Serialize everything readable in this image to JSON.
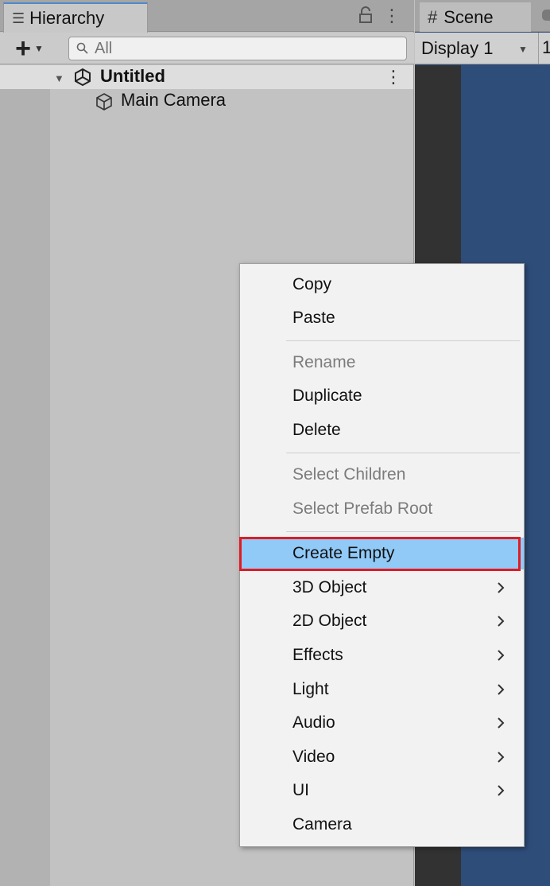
{
  "hierarchy": {
    "tab_label": "Hierarchy",
    "search_placeholder": "All",
    "scene_name": "Untitled",
    "items": [
      {
        "label": "Main Camera"
      }
    ]
  },
  "scene_panel": {
    "tab_label": "Scene",
    "display_select": "Display 1",
    "truncated_text": "1"
  },
  "context_menu": {
    "copy": "Copy",
    "paste": "Paste",
    "rename": "Rename",
    "duplicate": "Duplicate",
    "delete": "Delete",
    "select_children": "Select Children",
    "select_prefab_root": "Select Prefab Root",
    "create_empty": "Create Empty",
    "object_3d": "3D Object",
    "object_2d": "2D Object",
    "effects": "Effects",
    "light": "Light",
    "audio": "Audio",
    "video": "Video",
    "ui": "UI",
    "camera": "Camera",
    "highlighted_item": "Create Empty"
  },
  "colors": {
    "highlight_fill": "#91c9f7",
    "annotation_border": "#e11b23",
    "scene_background": "#2e4d79"
  }
}
